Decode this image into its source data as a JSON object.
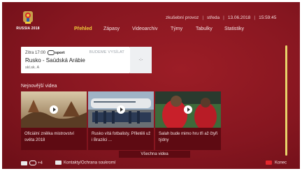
{
  "header": {
    "logo_icon": "world-cup-trophy-icon",
    "logo_text": "RUSSIA 2018",
    "status": {
      "mode": "zkušební provoz",
      "day": "středa",
      "date": "13.06.2018",
      "time": "15:59:45"
    },
    "nav": [
      {
        "label": "Přehled",
        "active": true
      },
      {
        "label": "Zápasy",
        "active": false
      },
      {
        "label": "Videoarchiv",
        "active": false
      },
      {
        "label": "Týmy",
        "active": false
      },
      {
        "label": "Tabulky",
        "active": false
      },
      {
        "label": "Statistiky",
        "active": false
      }
    ]
  },
  "live_match": {
    "time": "Zítra 17:00",
    "channel": "sport",
    "badge": "BUDEME VYSÍLAT",
    "title": "Rusko - Saúdská Arábie",
    "subtitle": "skl.sk. A",
    "score": "-:-"
  },
  "latest_videos": {
    "title": "Nejnovější videa",
    "items": [
      {
        "caption": "Oficiální znělka mistrovství světa 2018"
      },
      {
        "caption": "Rusko vítá fotbalisty. Přiletěli už i Brazilci ..."
      },
      {
        "caption": "Salah bude mimo hru tři až čtyři týdny"
      }
    ],
    "more_label": "Všechna videa"
  },
  "footer": {
    "key_label": "+4",
    "contacts_label": "Kontakty/Ochrana soukromí",
    "exit_label": "Konec"
  },
  "colors": {
    "background": "#861620",
    "accent": "#f0cf3c",
    "caption_bg": "#5e0a12",
    "exit_button": "#e4262c"
  }
}
